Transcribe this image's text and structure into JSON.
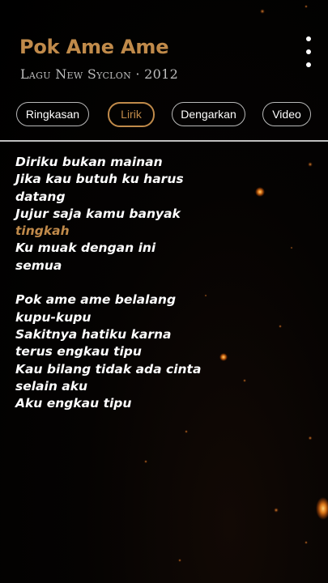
{
  "app": {
    "accent_color": "#c08a4a",
    "background_color": "#000000"
  },
  "header": {
    "title": "Pok Ame Ame",
    "subtitle": "Lagu New Syclon · 2012",
    "menu_icon": "more-vertical-icon"
  },
  "tabs": [
    {
      "label": "Ringkasan",
      "active": false
    },
    {
      "label": "Lirik",
      "active": true
    },
    {
      "label": "Dengarkan",
      "active": false
    },
    {
      "label": "Video",
      "active": false
    }
  ],
  "lyrics": {
    "stanzas": [
      {
        "lines": [
          {
            "text": "Diriku bukan mainan",
            "highlight": false
          },
          {
            "text": "Jika kau butuh ku harus",
            "highlight": false
          },
          {
            "text": "datang",
            "highlight": false
          },
          {
            "text": "Jujur saja kamu banyak",
            "highlight": false
          },
          {
            "text": "tingkah",
            "highlight": true
          },
          {
            "text": "Ku muak dengan ini",
            "highlight": false
          },
          {
            "text": "semua",
            "highlight": false
          }
        ]
      },
      {
        "lines": [
          {
            "text": "Pok ame ame belalang",
            "highlight": false
          },
          {
            "text": "kupu-kupu",
            "highlight": false
          },
          {
            "text": "Sakitnya hatiku karna",
            "highlight": false
          },
          {
            "text": "terus engkau tipu",
            "highlight": false
          },
          {
            "text": "Kau bilang tidak ada cinta",
            "highlight": false
          },
          {
            "text": "selain aku",
            "highlight": false
          },
          {
            "text": "Aku engkau tipu",
            "highlight": false
          }
        ]
      }
    ]
  }
}
